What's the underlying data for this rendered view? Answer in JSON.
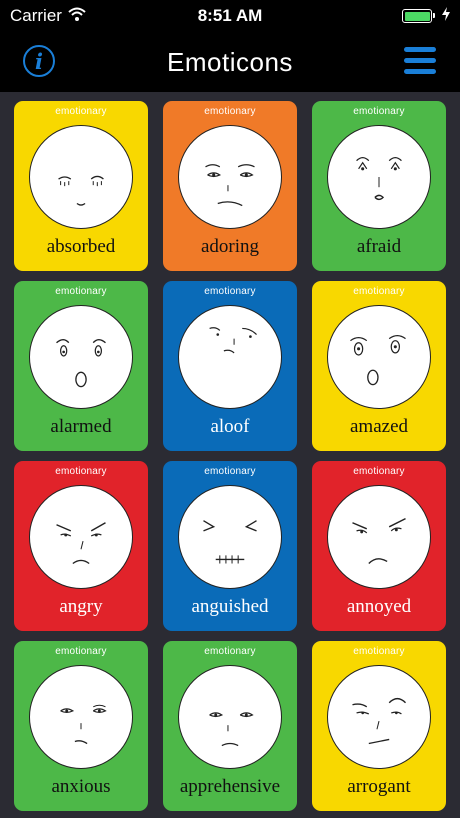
{
  "status_bar": {
    "carrier": "Carrier",
    "time": "8:51 AM",
    "battery_level": 1.0
  },
  "nav": {
    "title": "Emoticons",
    "info_icon": "info-icon",
    "menu_icon": "hamburger-menu-icon"
  },
  "colors": {
    "yellow": "#f8d800",
    "orange": "#f07a28",
    "green": "#4db848",
    "blue": "#0a6bb8",
    "red": "#e1232a",
    "accent": "#1a7fd8"
  },
  "cards": [
    {
      "brand": "emotionary",
      "label": "absorbed",
      "color": "#f8d800",
      "light": false
    },
    {
      "brand": "emotionary",
      "label": "adoring",
      "color": "#f07a28",
      "light": false
    },
    {
      "brand": "emotionary",
      "label": "afraid",
      "color": "#4db848",
      "light": false
    },
    {
      "brand": "emotionary",
      "label": "alarmed",
      "color": "#4db848",
      "light": false
    },
    {
      "brand": "emotionary",
      "label": "aloof",
      "color": "#0a6bb8",
      "light": true
    },
    {
      "brand": "emotionary",
      "label": "amazed",
      "color": "#f8d800",
      "light": false
    },
    {
      "brand": "emotionary",
      "label": "angry",
      "color": "#e1232a",
      "light": true
    },
    {
      "brand": "emotionary",
      "label": "anguished",
      "color": "#0a6bb8",
      "light": true
    },
    {
      "brand": "emotionary",
      "label": "annoyed",
      "color": "#e1232a",
      "light": true
    },
    {
      "brand": "emotionary",
      "label": "anxious",
      "color": "#4db848",
      "light": false
    },
    {
      "brand": "emotionary",
      "label": "apprehensive",
      "color": "#4db848",
      "light": false
    },
    {
      "brand": "emotionary",
      "label": "arrogant",
      "color": "#f8d800",
      "light": false
    }
  ]
}
